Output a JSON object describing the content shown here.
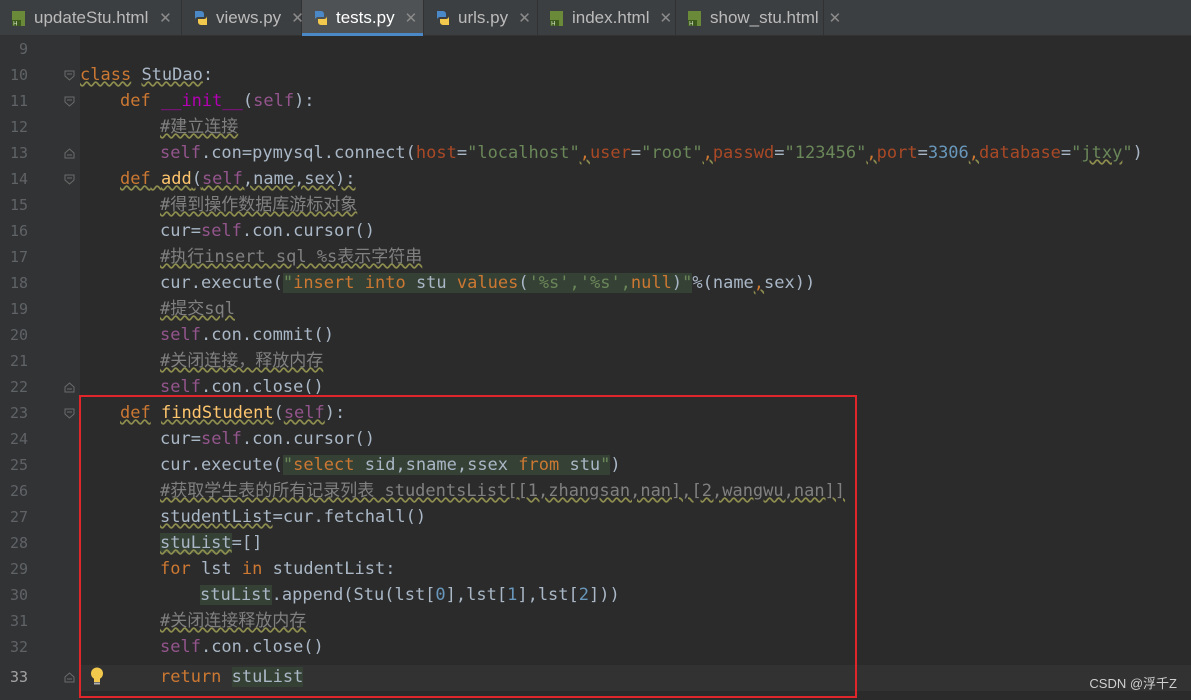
{
  "tabs": [
    {
      "label": "updateStu.html",
      "type": "html",
      "active": false
    },
    {
      "label": "views.py",
      "type": "python",
      "active": false
    },
    {
      "label": "tests.py",
      "type": "python",
      "active": true
    },
    {
      "label": "urls.py",
      "type": "python",
      "active": false
    },
    {
      "label": "index.html",
      "type": "html",
      "active": false
    },
    {
      "label": "show_stu.html",
      "type": "html",
      "active": false
    }
  ],
  "tab_close_glyph": "✕",
  "line_numbers": [
    "9",
    "10",
    "11",
    "12",
    "13",
    "14",
    "15",
    "16",
    "17",
    "18",
    "19",
    "20",
    "21",
    "22",
    "23",
    "24",
    "25",
    "26",
    "27",
    "28",
    "29",
    "30",
    "31",
    "32",
    "33"
  ],
  "code": {
    "l10": {
      "kw": "class",
      "name": "StuDao",
      "tail": ":"
    },
    "l11": {
      "kw": "def",
      "fn": "__init__",
      "open": "(",
      "self": "self",
      "close": "):"
    },
    "l12": {
      "comment": "#建立连接"
    },
    "l13": {
      "self": "self",
      "a": ".con=pymysql.connect(",
      "p_host": "host",
      "eq": "=",
      "s_host": "\"localhost\"",
      "c1": ",",
      "p_user": "user",
      "s_user": "\"root\"",
      "c2": ",",
      "p_passwd": "passwd",
      "s_passwd": "\"123456\"",
      "c3": ",",
      "p_port": "port",
      "n_port": "3306",
      "c4": ",",
      "p_db": "database",
      "s_db_open": "\"",
      "s_db": "jtxy",
      "s_db_close": "\"",
      "end": ")"
    },
    "l14": {
      "kw": "def",
      "fn": "add",
      "open": "(",
      "self": "self",
      "args": ",name,sex):"
    },
    "l15": {
      "comment": "#得到操作数据库游标对象"
    },
    "l16": {
      "a": "cur=",
      "self": "self",
      "b": ".con.cursor()"
    },
    "l17": {
      "comment": "#执行insert sql %s表示字符串"
    },
    "l18": {
      "a": "cur.execute(",
      "q1": "\"",
      "k1": "insert",
      "sp1": " ",
      "k2": "into",
      "t1": " stu ",
      "k3": "values",
      "t2": "(",
      "s1": "'%s','%s',",
      "k4": "null",
      "t3": ")",
      "q2": "\"",
      "b": "%(name",
      "c": ",",
      "d": "sex))"
    },
    "l19": {
      "comment": "#提交sql"
    },
    "l20": {
      "self": "self",
      "a": ".con.commit()"
    },
    "l21": {
      "comment": "#关闭连接，释放内存"
    },
    "l22": {
      "self": "self",
      "a": ".con.close()"
    },
    "l23": {
      "kw": "def",
      "fn": "findStudent",
      "open": "(",
      "self": "self",
      "close": "):"
    },
    "l24": {
      "a": "cur=",
      "self": "self",
      "b": ".con.cursor()"
    },
    "l25": {
      "a": "cur.execute(",
      "q1": "\"",
      "k1": "select",
      "t1": " sid,sname,ssex ",
      "k2": "from",
      "t2": " stu",
      "q2": "\"",
      "end": ")"
    },
    "l26": {
      "comment": "#获取学生表的所有记录列表 studentsList[[1,zhangsan,nan],[2,wangwu,nan]]"
    },
    "l27": {
      "a": "studentList",
      "b": "=cur.fetchall()"
    },
    "l28": {
      "a": "stuList",
      "b": "=[]"
    },
    "l29": {
      "kw1": "for",
      "a": " lst ",
      "kw2": "in",
      "b": " studentList:"
    },
    "l30": {
      "a": "stuList",
      "b": ".append(Stu(lst[",
      "n0": "0",
      "c": "],lst[",
      "n1": "1",
      "d": "],lst[",
      "n2": "2",
      "e": "]))"
    },
    "l31": {
      "comment": "#关闭连接释放内存"
    },
    "l32": {
      "self": "self",
      "a": ".con.close()"
    },
    "l33": {
      "kw": "return",
      "sp": " ",
      "a": "stuList"
    }
  },
  "watermark": "CSDN @浮千Z",
  "colors": {
    "highlight_box": "#e0262b",
    "keyword": "#cc7832",
    "function": "#ffc66d",
    "string": "#6a8759",
    "number": "#6897bb",
    "comment": "#808080",
    "self": "#94558d"
  }
}
